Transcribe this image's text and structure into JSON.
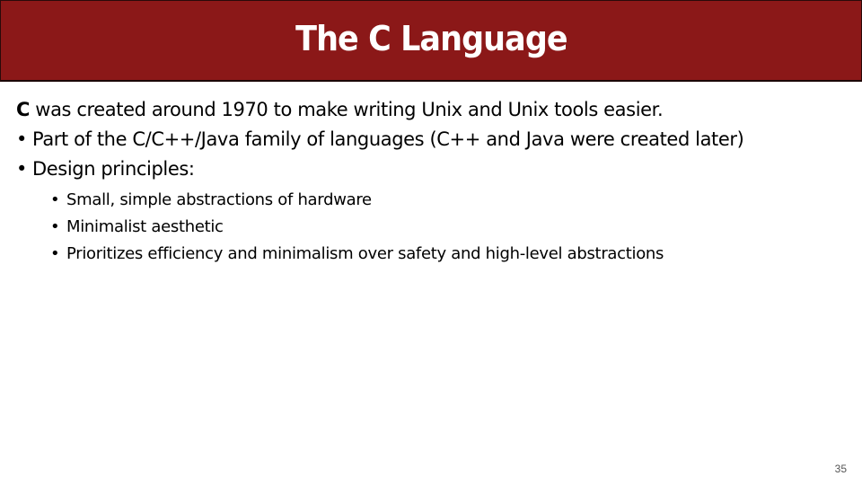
{
  "slide": {
    "title": "The C Language",
    "intro": {
      "bold_lead": "C",
      "rest": " was created around 1970 to make writing Unix and Unix tools easier."
    },
    "bullets": [
      "Part of the C/C++/Java family of languages (C++ and Java were created later)",
      "Design principles:"
    ],
    "sub_bullets": [
      "Small, simple abstractions of hardware",
      "Minimalist aesthetic",
      "Prioritizes efficiency and minimalism over safety and high-level abstractions"
    ],
    "bullet_glyph": "•",
    "page_number": "35",
    "colors": {
      "header_bg": "#8b1818",
      "title_text": "#ffffff"
    }
  }
}
